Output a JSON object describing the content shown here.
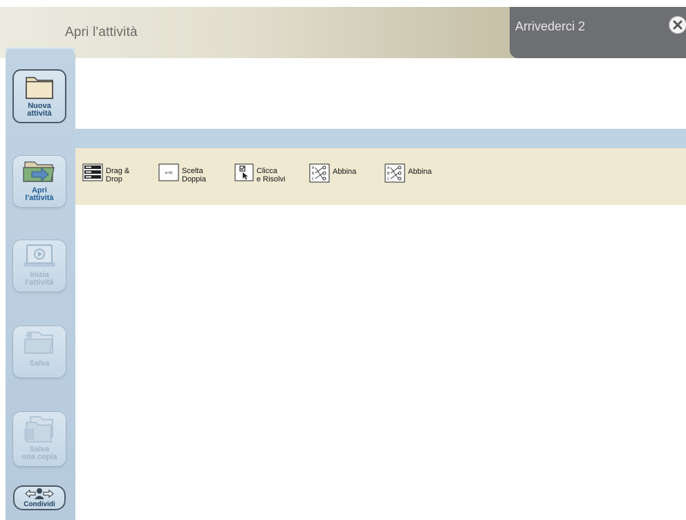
{
  "header": {
    "title": "Apri l'attività",
    "right_title": "Arrivederci 2"
  },
  "sidebar": {
    "items": [
      {
        "label": "Nuova\nattività",
        "icon": "folder-icon",
        "state": "normal"
      },
      {
        "label": "Apri\nl'attività",
        "icon": "open-folder-icon",
        "state": "active"
      },
      {
        "label": "Inizia\nl'attività",
        "icon": "play-screen-icon",
        "state": "disabled"
      },
      {
        "label": "Salva",
        "icon": "save-icon",
        "state": "disabled"
      },
      {
        "label": "Salva\nuna copia",
        "icon": "save-copy-icon",
        "state": "disabled"
      },
      {
        "label": "Condividi",
        "icon": "share-icon",
        "state": "normal"
      }
    ]
  },
  "tools": [
    {
      "label": "Drag &\nDrop",
      "icon": "drag-drop-icon"
    },
    {
      "label": "Scelta\nDoppia",
      "icon": "double-choice-icon"
    },
    {
      "label": "Clicca\ne Risolvi",
      "icon": "click-solve-icon"
    },
    {
      "label": "Abbina",
      "icon": "match-icon"
    },
    {
      "label": "Abbina",
      "icon": "match-icon"
    }
  ],
  "colors": {
    "header_dark": "#6e6f73",
    "sidebar": "#c0d3e3",
    "band": "#bdd2e2",
    "strip": "#efe9d2",
    "label_active": "#1f5d94"
  }
}
